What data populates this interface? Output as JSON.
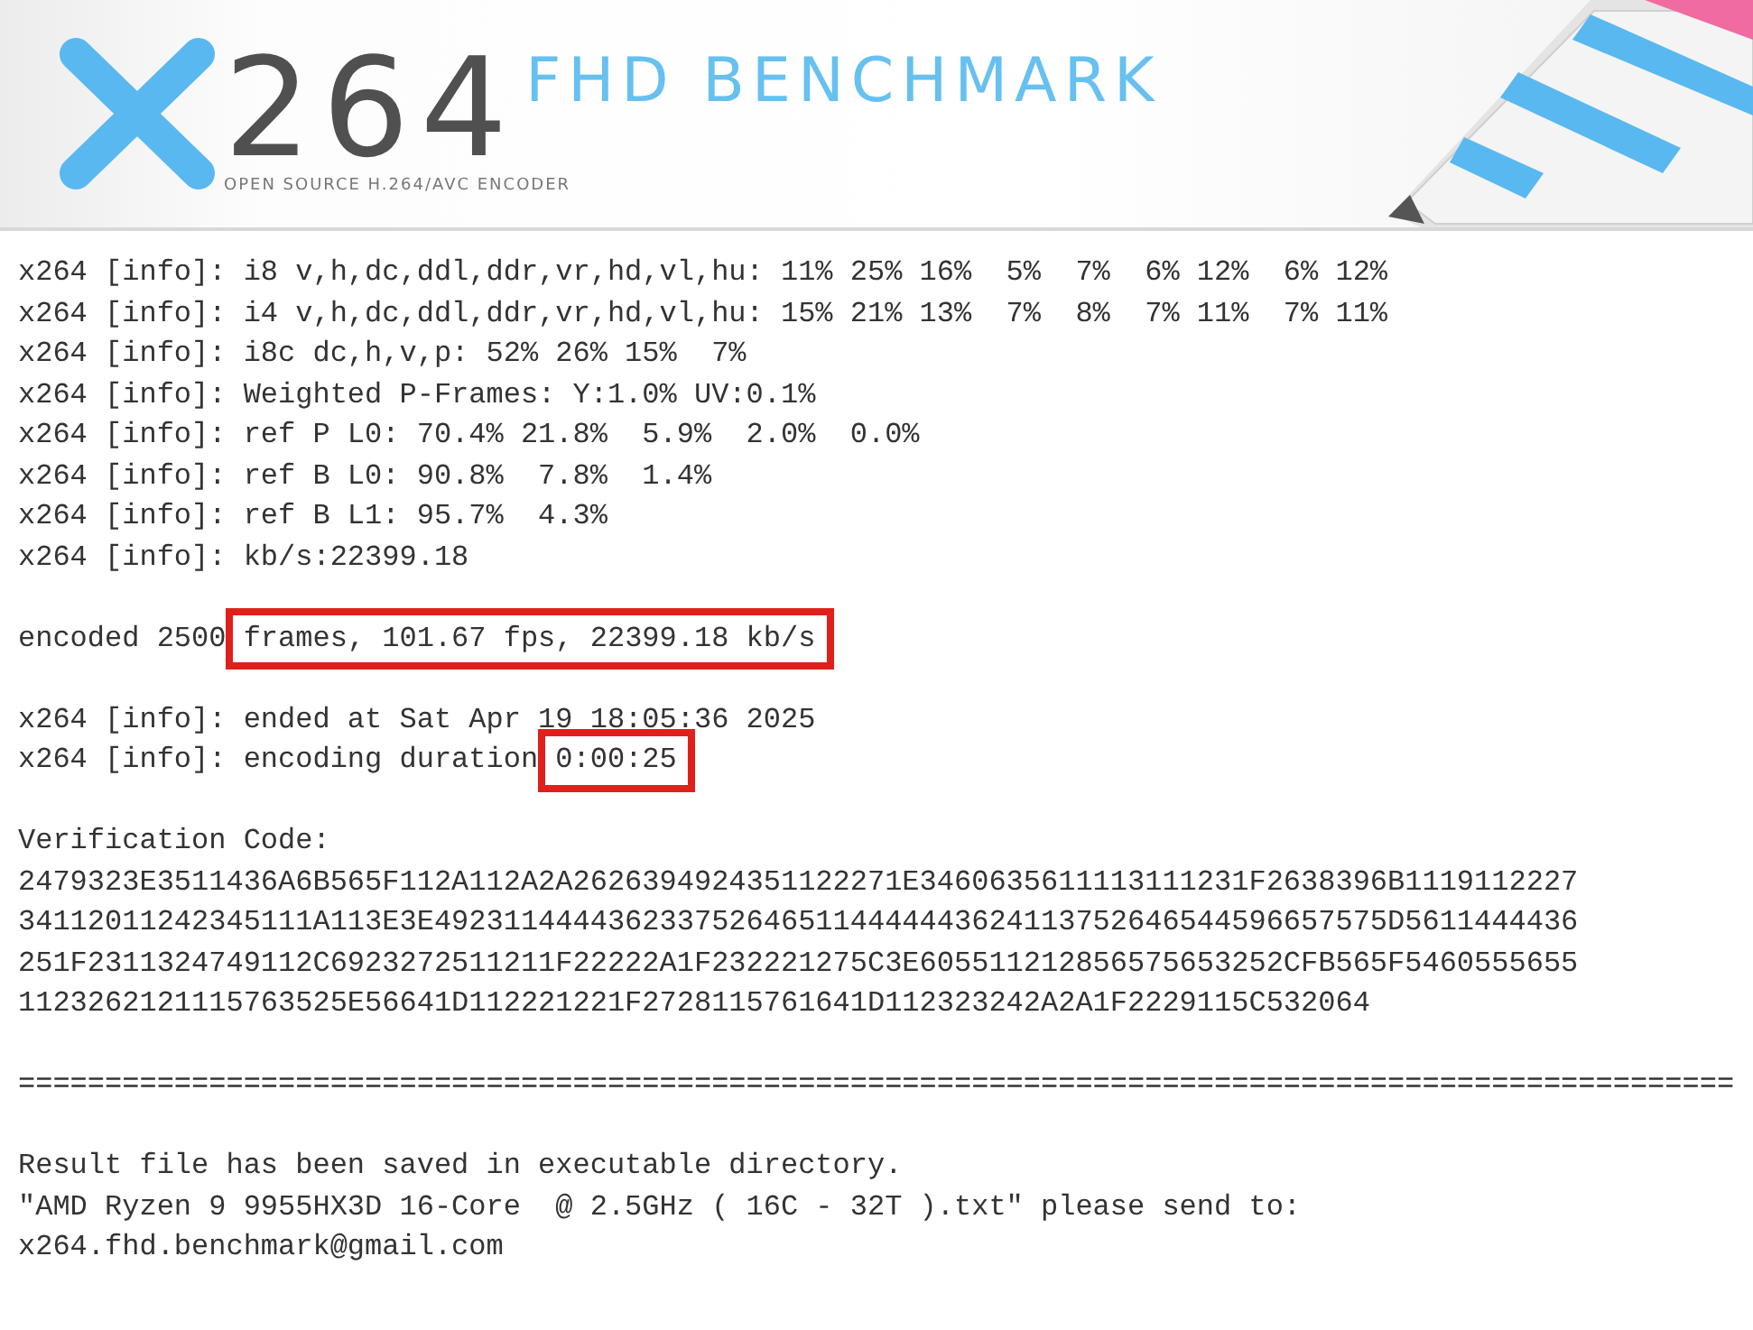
{
  "header": {
    "number": "264",
    "title": "FHD BENCHMARK",
    "subtitle": "OPEN SOURCE H.264/AVC ENCODER"
  },
  "console": [
    {
      "kind": "text",
      "segments": [
        {
          "text": "x264 [info]: i8 v,h,dc,ddl,ddr,vr,hd,vl,hu: 11% 25% 16%  5%  7%  6% 12%  6% 12%",
          "highlighted": false
        }
      ]
    },
    {
      "kind": "text",
      "segments": [
        {
          "text": "x264 [info]: i4 v,h,dc,ddl,ddr,vr,hd,vl,hu: 15% 21% 13%  7%  8%  7% 11%  7% 11%",
          "highlighted": false
        }
      ]
    },
    {
      "kind": "text",
      "segments": [
        {
          "text": "x264 [info]: i8c dc,h,v,p: 52% 26% 15%  7%",
          "highlighted": false
        }
      ]
    },
    {
      "kind": "text",
      "segments": [
        {
          "text": "x264 [info]: Weighted P-Frames: Y:1.0% UV:0.1%",
          "highlighted": false
        }
      ]
    },
    {
      "kind": "text",
      "segments": [
        {
          "text": "x264 [info]: ref P L0: 70.4% 21.8%  5.9%  2.0%  0.0%",
          "highlighted": false
        }
      ]
    },
    {
      "kind": "text",
      "segments": [
        {
          "text": "x264 [info]: ref B L0: 90.8%  7.8%  1.4%",
          "highlighted": false
        }
      ]
    },
    {
      "kind": "text",
      "segments": [
        {
          "text": "x264 [info]: ref B L1: 95.7%  4.3%",
          "highlighted": false
        }
      ]
    },
    {
      "kind": "text",
      "segments": [
        {
          "text": "x264 [info]: kb/s:22399.18",
          "highlighted": false
        }
      ]
    },
    {
      "kind": "blank"
    },
    {
      "kind": "text",
      "segments": [
        {
          "text": "encoded 2500 ",
          "highlighted": false
        },
        {
          "text": "frames, 101.67 fps, 22399.18 kb/s",
          "highlighted": true
        }
      ]
    },
    {
      "kind": "blank"
    },
    {
      "kind": "text",
      "segments": [
        {
          "text": "x264 [info]: ended at Sat Apr 19 18:05:36 2025",
          "highlighted": false
        }
      ]
    },
    {
      "kind": "text",
      "segments": [
        {
          "text": "x264 [info]: encoding duration ",
          "highlighted": false
        },
        {
          "text": "0:00:25",
          "highlighted": true
        }
      ]
    },
    {
      "kind": "blank"
    },
    {
      "kind": "text",
      "segments": [
        {
          "text": "Verification Code:",
          "highlighted": false
        }
      ]
    },
    {
      "kind": "text",
      "segments": [
        {
          "text": "2479323E3511436A6B565F112A112A2A2626394924351122271E3460635611113111231F2638396B1119112227",
          "highlighted": false
        }
      ]
    },
    {
      "kind": "text",
      "segments": [
        {
          "text": "34112011242345111A113E3E4923114444362337526465114444443624113752646544596657575D5611444436",
          "highlighted": false
        }
      ]
    },
    {
      "kind": "text",
      "segments": [
        {
          "text": "251F2311324749112C6923272511211F22222A1F232221275C3E605511212856575653252CFB565F5460555655",
          "highlighted": false
        }
      ]
    },
    {
      "kind": "text",
      "segments": [
        {
          "text": "1123262121115763525E56641D112221221F2728115761641D112323242A2A1F2229115C532064",
          "highlighted": false
        }
      ]
    },
    {
      "kind": "blank"
    },
    {
      "kind": "text",
      "segments": [
        {
          "text": "===================================================================================================",
          "highlighted": false
        }
      ]
    },
    {
      "kind": "blank"
    },
    {
      "kind": "text",
      "segments": [
        {
          "text": "Result file has been saved in executable directory.",
          "highlighted": false
        }
      ]
    },
    {
      "kind": "text",
      "segments": [
        {
          "text": "\"AMD Ryzen 9 9955HX3D 16-Core  @ 2.5GHz ( 16C - 32T ).txt\" please send to:",
          "highlighted": false
        }
      ]
    },
    {
      "kind": "text",
      "segments": [
        {
          "text": "x264.fhd.benchmark@gmail.com",
          "highlighted": false
        }
      ]
    }
  ]
}
